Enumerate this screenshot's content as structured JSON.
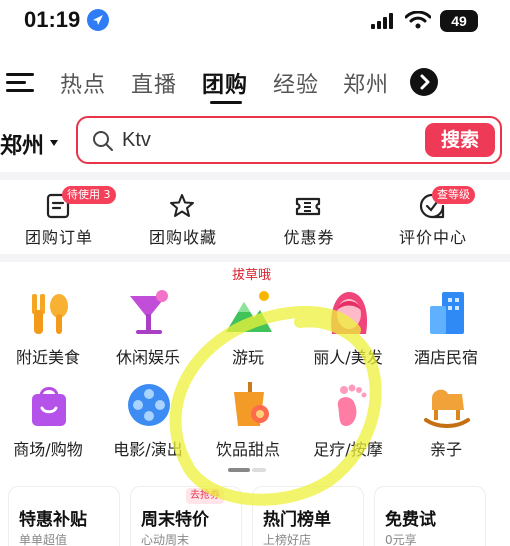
{
  "status_bar": {
    "time": "01:19",
    "battery": "49"
  },
  "tabs": [
    {
      "label": "热点",
      "active": false
    },
    {
      "label": "直播",
      "active": false
    },
    {
      "label": "团购",
      "active": true
    },
    {
      "label": "经验",
      "active": false
    },
    {
      "label": "郑州",
      "active": false
    }
  ],
  "search": {
    "city": "郑州",
    "query": "Ktv",
    "button_label": "搜索"
  },
  "quick_actions": [
    {
      "label": "团购订单",
      "badge": "待使用 3",
      "icon": "order-icon"
    },
    {
      "label": "团购收藏",
      "badge": "",
      "icon": "star-icon"
    },
    {
      "label": "优惠券",
      "badge": "",
      "icon": "coupon-icon"
    },
    {
      "label": "评价中心",
      "badge": "查等级",
      "icon": "review-icon"
    }
  ],
  "annotation": "拔草哦",
  "categories": [
    {
      "label": "附近美食",
      "icon": "food-icon"
    },
    {
      "label": "休闲娱乐",
      "icon": "cocktail-icon"
    },
    {
      "label": "游玩",
      "icon": "mountain-icon"
    },
    {
      "label": "丽人/美发",
      "icon": "beauty-icon"
    },
    {
      "label": "酒店民宿",
      "icon": "hotel-icon"
    },
    {
      "label": "商场/购物",
      "icon": "shopping-bag-icon"
    },
    {
      "label": "电影/演出",
      "icon": "film-reel-icon"
    },
    {
      "label": "饮品甜点",
      "icon": "drink-icon"
    },
    {
      "label": "足疗/按摩",
      "icon": "foot-icon"
    },
    {
      "label": "亲子",
      "icon": "rocking-horse-icon"
    }
  ],
  "cards": [
    {
      "title": "特惠补贴",
      "subtitle": "单单超值"
    },
    {
      "title": "周末特价",
      "subtitle": "心动周末",
      "tag": "去抢券"
    },
    {
      "title": "热门榜单",
      "subtitle": "上榜好店"
    },
    {
      "title": "免费试",
      "subtitle": "0元享"
    }
  ],
  "colors": {
    "accent": "#ee3a57",
    "highlighter": "#eef23a"
  }
}
